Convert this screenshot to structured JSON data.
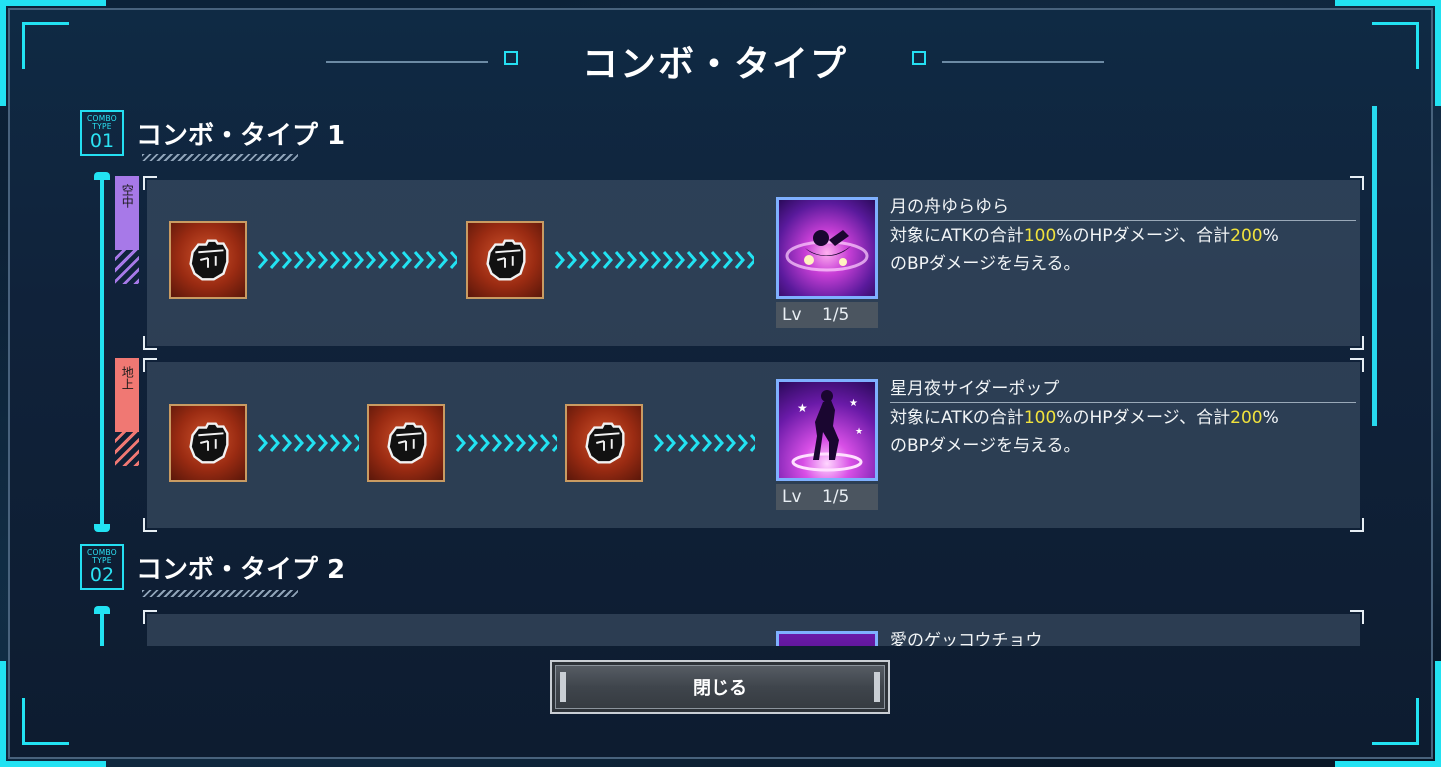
{
  "title": "コンボ・タイプ",
  "colors": {
    "accent": "#22e2f2",
    "highlight": "#f0e23c",
    "air": "#a779e8",
    "ground": "#f07873"
  },
  "sections": [
    {
      "badge_top": "COMBO\nTYPE",
      "badge_num": "01",
      "title": "コンボ・タイプ 1",
      "combos": [
        {
          "tag": "空中",
          "inputs": [
            "fist-icon",
            "fist-icon"
          ],
          "skill": {
            "name": "月の舟ゆらゆら",
            "lv_label": "Lv",
            "lv_value": "1/5",
            "desc_a": "対象にATKの合計",
            "desc_pct1": "100",
            "desc_b": "%のHPダメージ、合計",
            "desc_pct2": "200",
            "desc_c": "%",
            "desc_d": "のBPダメージを与える。"
          }
        },
        {
          "tag": "地上",
          "inputs": [
            "fist-icon",
            "fist-icon",
            "fist-icon"
          ],
          "skill": {
            "name": "星月夜サイダーポップ",
            "lv_label": "Lv",
            "lv_value": "1/5",
            "desc_a": "対象にATKの合計",
            "desc_pct1": "100",
            "desc_b": "%のHPダメージ、合計",
            "desc_pct2": "200",
            "desc_c": "%",
            "desc_d": "のBPダメージを与える。"
          }
        }
      ]
    },
    {
      "badge_top": "COMBO\nTYPE",
      "badge_num": "02",
      "title": "コンボ・タイプ 2",
      "combos": [
        {
          "skill": {
            "name": "愛のゲッコウチョウ"
          }
        }
      ]
    }
  ],
  "close_label": "閉じる"
}
